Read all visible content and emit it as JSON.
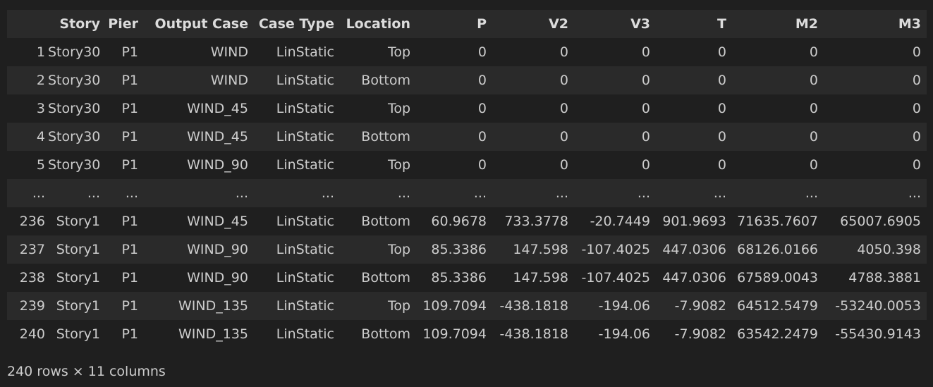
{
  "table": {
    "columns": [
      "",
      "Story",
      "Pier",
      "Output Case",
      "Case Type",
      "Location",
      "P",
      "V2",
      "V3",
      "T",
      "M2",
      "M3"
    ],
    "rows": [
      [
        "1",
        "Story30",
        "P1",
        "WIND",
        "LinStatic",
        "Top",
        "0",
        "0",
        "0",
        "0",
        "0",
        "0"
      ],
      [
        "2",
        "Story30",
        "P1",
        "WIND",
        "LinStatic",
        "Bottom",
        "0",
        "0",
        "0",
        "0",
        "0",
        "0"
      ],
      [
        "3",
        "Story30",
        "P1",
        "WIND_45",
        "LinStatic",
        "Top",
        "0",
        "0",
        "0",
        "0",
        "0",
        "0"
      ],
      [
        "4",
        "Story30",
        "P1",
        "WIND_45",
        "LinStatic",
        "Bottom",
        "0",
        "0",
        "0",
        "0",
        "0",
        "0"
      ],
      [
        "5",
        "Story30",
        "P1",
        "WIND_90",
        "LinStatic",
        "Top",
        "0",
        "0",
        "0",
        "0",
        "0",
        "0"
      ],
      [
        "...",
        "...",
        "...",
        "...",
        "...",
        "...",
        "...",
        "...",
        "...",
        "...",
        "...",
        "..."
      ],
      [
        "236",
        "Story1",
        "P1",
        "WIND_45",
        "LinStatic",
        "Bottom",
        "60.9678",
        "733.3778",
        "-20.7449",
        "901.9693",
        "71635.7607",
        "65007.6905"
      ],
      [
        "237",
        "Story1",
        "P1",
        "WIND_90",
        "LinStatic",
        "Top",
        "85.3386",
        "147.598",
        "-107.4025",
        "447.0306",
        "68126.0166",
        "4050.398"
      ],
      [
        "238",
        "Story1",
        "P1",
        "WIND_90",
        "LinStatic",
        "Bottom",
        "85.3386",
        "147.598",
        "-107.4025",
        "447.0306",
        "67589.0043",
        "4788.3881"
      ],
      [
        "239",
        "Story1",
        "P1",
        "WIND_135",
        "LinStatic",
        "Top",
        "109.7094",
        "-438.1818",
        "-194.06",
        "-7.9082",
        "64512.5479",
        "-53240.0053"
      ],
      [
        "240",
        "Story1",
        "P1",
        "WIND_135",
        "LinStatic",
        "Bottom",
        "109.7094",
        "-438.1818",
        "-194.06",
        "-7.9082",
        "63542.2479",
        "-55430.9143"
      ]
    ]
  },
  "footer": {
    "shape_text": "240 rows × 11 columns"
  }
}
